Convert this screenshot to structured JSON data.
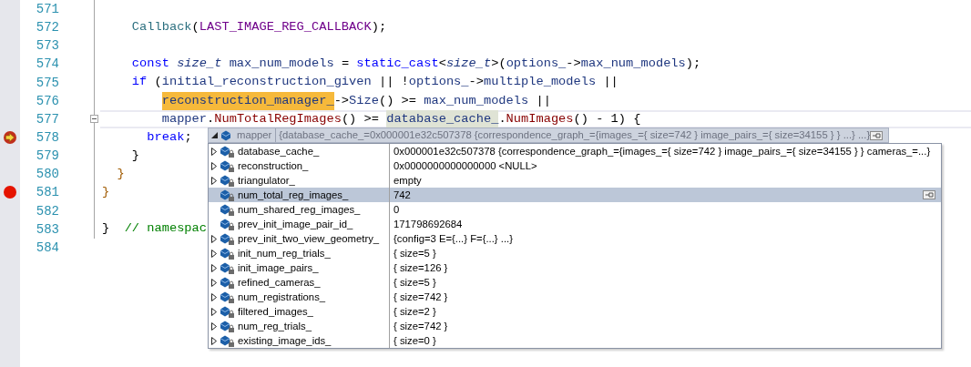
{
  "editor": {
    "lines": [
      {
        "number": "571",
        "current": false,
        "foldable": false,
        "breakpoint": false,
        "current_statement": false
      },
      {
        "number": "572",
        "current": false,
        "foldable": false,
        "breakpoint": false,
        "current_statement": false,
        "tokens": [
          {
            "kind": "function",
            "text": "    Callback"
          },
          {
            "kind": "punct",
            "text": "("
          },
          {
            "kind": "macro",
            "text": "LAST_IMAGE_REG_CALLBACK"
          },
          {
            "kind": "punct",
            "text": ");"
          }
        ]
      },
      {
        "number": "573",
        "current": false,
        "foldable": false,
        "breakpoint": false,
        "current_statement": false
      },
      {
        "number": "574",
        "current": false,
        "foldable": false,
        "breakpoint": false,
        "current_statement": false,
        "tokens": [
          {
            "kind": "keyword",
            "text": "    const "
          },
          {
            "kind": "type",
            "text": "size_t "
          },
          {
            "kind": "variable",
            "text": "max_num_models"
          },
          {
            "kind": "punct",
            "text": " = "
          },
          {
            "kind": "keyword",
            "text": "static_cast"
          },
          {
            "kind": "punct",
            "text": "<"
          },
          {
            "kind": "type",
            "text": "size_t"
          },
          {
            "kind": "punct",
            "text": ">("
          },
          {
            "kind": "variable",
            "text": "options_"
          },
          {
            "kind": "punct",
            "text": "->"
          },
          {
            "kind": "variable",
            "text": "max_num_models"
          },
          {
            "kind": "punct",
            "text": ");"
          }
        ]
      },
      {
        "number": "575",
        "current": false,
        "foldable": false,
        "breakpoint": false,
        "current_statement": false,
        "tokens": [
          {
            "kind": "keyword",
            "text": "    if"
          },
          {
            "kind": "punct",
            "text": " ("
          },
          {
            "kind": "variable",
            "text": "initial_reconstruction_given"
          },
          {
            "kind": "punct",
            "text": " || !"
          },
          {
            "kind": "variable",
            "text": "options_"
          },
          {
            "kind": "punct",
            "text": "->"
          },
          {
            "kind": "variable",
            "text": "multiple_models"
          },
          {
            "kind": "punct",
            "text": " ||"
          }
        ]
      },
      {
        "number": "576",
        "current": false,
        "foldable": false,
        "breakpoint": false,
        "current_statement": false,
        "tokens": [
          {
            "kind": "highlight",
            "text": "        reconstruction_manager_"
          },
          {
            "kind": "punct",
            "text": "->"
          },
          {
            "kind": "variable",
            "text": "Size"
          },
          {
            "kind": "punct",
            "text": "() >= "
          },
          {
            "kind": "variable",
            "text": "max_num_models"
          },
          {
            "kind": "punct",
            "text": " ||"
          }
        ]
      },
      {
        "number": "577",
        "current": true,
        "foldable": true,
        "breakpoint": false,
        "current_statement": false,
        "tokens": [
          {
            "kind": "variable",
            "text": "        mapper"
          },
          {
            "kind": "punct",
            "text": "."
          },
          {
            "kind": "method",
            "text": "NumTotalRegImages"
          },
          {
            "kind": "punct",
            "text": "() >= "
          },
          {
            "kind": "reference",
            "text": "database_cache_"
          },
          {
            "kind": "punct",
            "text": "."
          },
          {
            "kind": "method",
            "text": "NumImages"
          },
          {
            "kind": "punct",
            "text": "() - 1) {"
          }
        ]
      },
      {
        "number": "578",
        "current": false,
        "foldable": false,
        "breakpoint": true,
        "current_statement": true,
        "tokens": [
          {
            "kind": "keyword",
            "text": "      break"
          },
          {
            "kind": "punct",
            "text": ";"
          }
        ]
      },
      {
        "number": "579",
        "current": false,
        "foldable": false,
        "breakpoint": false,
        "current_statement": false,
        "tokens": [
          {
            "kind": "punct",
            "text": "    }"
          }
        ]
      },
      {
        "number": "580",
        "current": false,
        "foldable": false,
        "breakpoint": false,
        "current_statement": false,
        "tokens": [
          {
            "kind": "brace",
            "text": "  }"
          }
        ]
      },
      {
        "number": "581",
        "current": false,
        "foldable": false,
        "breakpoint": true,
        "current_statement": false,
        "tokens": [
          {
            "kind": "brace",
            "text": "}"
          }
        ]
      },
      {
        "number": "582",
        "current": false,
        "foldable": false,
        "breakpoint": false,
        "current_statement": false
      },
      {
        "number": "583",
        "current": false,
        "foldable": false,
        "breakpoint": false,
        "current_statement": false,
        "tokens": [
          {
            "kind": "punct",
            "text": "}"
          },
          {
            "kind": "comment",
            "text": "  // namespac"
          }
        ]
      },
      {
        "number": "584",
        "current": false,
        "foldable": false,
        "breakpoint": false,
        "current_statement": false
      }
    ]
  },
  "datatip": {
    "expression": "mapper",
    "value": "{database_cache_=0x000001e32c507378 {correspondence_graph_={images_={ size=742 } image_pairs_={ size=34155 } } ...} ...}",
    "rows": [
      {
        "name": "database_cache_",
        "value": "0x000001e32c507378 {correspondence_graph_={images_={ size=742 } image_pairs_={ size=34155 } } cameras_=...}",
        "expandable": true,
        "selected": false
      },
      {
        "name": "reconstruction_",
        "value": "0x0000000000000000 <NULL>",
        "expandable": true,
        "selected": false
      },
      {
        "name": "triangulator_",
        "value": "empty",
        "expandable": true,
        "selected": false
      },
      {
        "name": "num_total_reg_images_",
        "value": "742",
        "expandable": false,
        "selected": true
      },
      {
        "name": "num_shared_reg_images_",
        "value": "0",
        "expandable": false,
        "selected": false
      },
      {
        "name": "prev_init_image_pair_id_",
        "value": "171798692684",
        "expandable": false,
        "selected": false
      },
      {
        "name": "prev_init_two_view_geometry_",
        "value": "{config=3 E={...} F={...} ...}",
        "expandable": true,
        "selected": false
      },
      {
        "name": "init_num_reg_trials_",
        "value": "{ size=5 }",
        "expandable": true,
        "selected": false
      },
      {
        "name": "init_image_pairs_",
        "value": "{ size=126 }",
        "expandable": true,
        "selected": false
      },
      {
        "name": "refined_cameras_",
        "value": "{ size=5 }",
        "expandable": true,
        "selected": false
      },
      {
        "name": "num_registrations_",
        "value": "{ size=742 }",
        "expandable": true,
        "selected": false
      },
      {
        "name": "filtered_images_",
        "value": "{ size=2 }",
        "expandable": true,
        "selected": false
      },
      {
        "name": "num_reg_trials_",
        "value": "{ size=742 }",
        "expandable": true,
        "selected": false
      },
      {
        "name": "existing_image_ids_",
        "value": "{ size=0 }",
        "expandable": true,
        "selected": false
      }
    ]
  }
}
